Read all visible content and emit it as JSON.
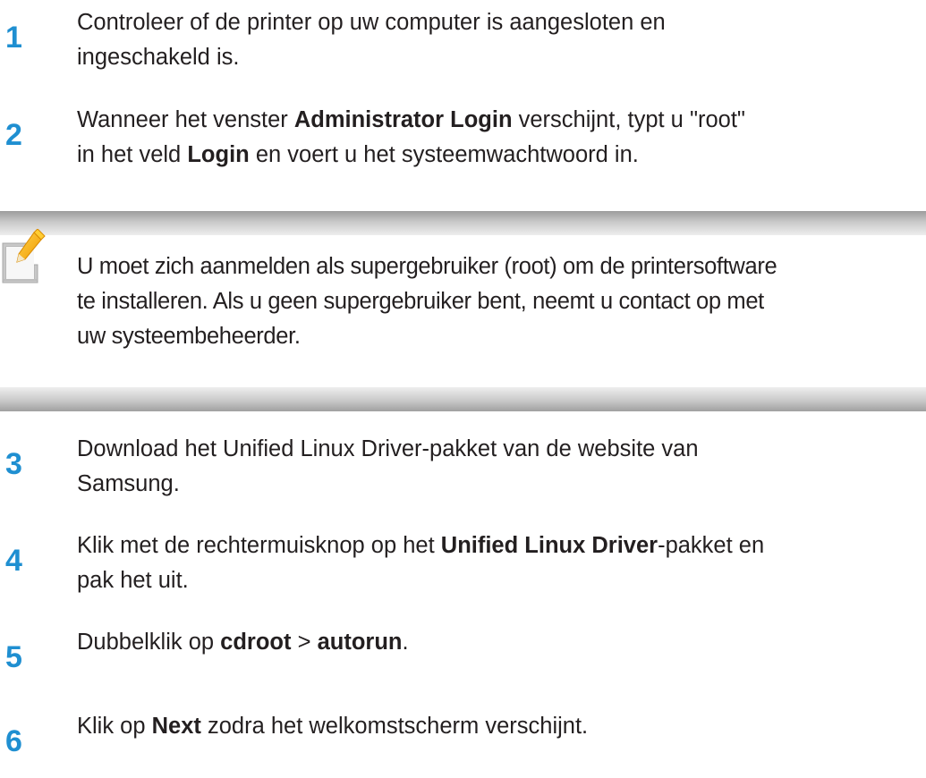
{
  "steps": [
    {
      "number": "1",
      "lines": [
        [
          "Controleer of de printer op uw computer is aangesloten en"
        ],
        [
          "ingeschakeld is."
        ]
      ]
    },
    {
      "number": "2",
      "lines": [
        [
          "Wanneer het venster ",
          {
            "b": "Administrator Login"
          },
          " verschijnt, typt u \"root\""
        ],
        [
          "in het veld ",
          {
            "b": "Login"
          },
          " en voert u het systeemwachtwoord in."
        ]
      ]
    },
    {
      "number": "3",
      "lines": [
        [
          "Download het Unified Linux Driver-pakket van de website van"
        ],
        [
          "Samsung."
        ]
      ]
    },
    {
      "number": "4",
      "lines": [
        [
          "Klik met de rechtermuisknop op het ",
          {
            "b": "Unified Linux Driver"
          },
          "-pakket en"
        ],
        [
          "pak het uit."
        ]
      ]
    },
    {
      "number": "5",
      "lines": [
        [
          "Dubbelklik op ",
          {
            "b": "cdroot"
          },
          " > ",
          {
            "b": "autorun"
          },
          "."
        ]
      ]
    },
    {
      "number": "6",
      "lines": [
        [
          "Klik op ",
          {
            "b": "Next"
          },
          " zodra het welkomstscherm verschijnt."
        ]
      ]
    }
  ],
  "note": {
    "icon": "note-pencil-icon",
    "lines": [
      "U moet zich aanmelden als supergebruiker (root) om de printersoftware",
      "te installeren. Als u geen supergebruiker bent, neemt u contact op met",
      "uw systeembeheerder."
    ]
  },
  "colors": {
    "step_number": "#1f8fd1",
    "text": "#231f20",
    "icon_pencil": "#f2a900"
  }
}
